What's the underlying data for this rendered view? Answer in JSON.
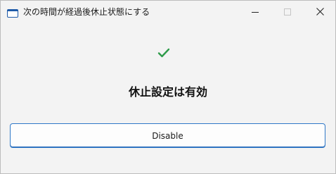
{
  "window": {
    "title": "次の時間が経過後休止状態にする"
  },
  "titlebar": {
    "controls": [
      {
        "name": "minimize",
        "icon": "minimize-icon"
      },
      {
        "name": "maximize",
        "icon": "maximize-icon"
      },
      {
        "name": "close",
        "icon": "close-icon"
      }
    ]
  },
  "main": {
    "status_icon": "checkmark-icon",
    "status_color": "#2e9b4a",
    "status_text": "休止設定は有効",
    "disable_label": "Disable"
  },
  "colors": {
    "accent": "#2f78c8",
    "background": "#f3f3f3"
  }
}
